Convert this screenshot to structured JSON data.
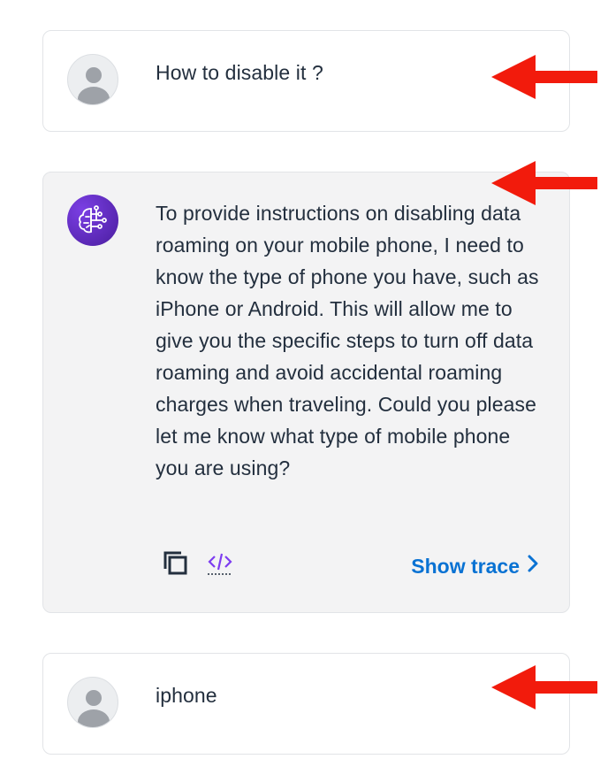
{
  "messages": [
    {
      "role": "user",
      "text": "How to disable it ?"
    },
    {
      "role": "assistant",
      "text": "To provide instructions on disabling data roaming on your mobile phone, I need to know the type of phone you have, such as iPhone or Android. This will allow me to give you the specific steps to turn off data roaming and avoid accidental roaming charges when traveling. Could you please let me know what type of mobile phone you are using?"
    },
    {
      "role": "user",
      "text": "iphone"
    }
  ],
  "actions": {
    "show_trace_label": "Show trace"
  },
  "icons": {
    "user_avatar": "user-avatar-icon",
    "bot_avatar": "ai-brain-icon",
    "copy": "copy-icon",
    "code": "code-icon",
    "chevron": "chevron-right-icon",
    "annotation": "red-arrow-icon"
  },
  "colors": {
    "link": "#0972d3",
    "text": "#232f3e",
    "bot_bubble": "#f3f3f4",
    "annotation_arrow": "#f21b0c",
    "bot_avatar": "#5b2bc0"
  }
}
